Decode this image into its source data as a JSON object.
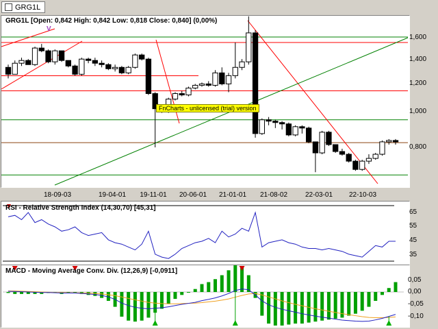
{
  "tab": {
    "label": "GRG1L"
  },
  "price_panel": {
    "title": "GRG1L [Open: 0,842  High: 0,842  Low: 0,818  Close: 0,840] (0,00%)",
    "marker": "V",
    "y_ticks": [
      "1,600",
      "1,400",
      "1,200",
      "1,000",
      "0,800"
    ],
    "x_ticks": [
      "18-09-03",
      "19-04-01",
      "19-11-01",
      "20-06-01",
      "21-01-01",
      "21-08-02",
      "22-03-01",
      "22-10-03"
    ],
    "watermark": "FnCharts - unlicensed (trial) version"
  },
  "rsi_panel": {
    "title": "RSI - Relative Strength Index (14,30,70) [45,31]",
    "y_ticks": [
      "65",
      "55",
      "45",
      "35"
    ]
  },
  "macd_panel": {
    "title": "MACD - Moving Average Conv. Div. (12,26,9) [-0,0911]",
    "y_ticks": [
      "0,05",
      "0,00",
      "-0,05",
      "-0,10"
    ]
  },
  "colors": {
    "up_candle": "#ffffff",
    "down_candle": "#000000",
    "rsi_line": "#2020c0",
    "macd_line": "#2020c0",
    "signal_line": "#f0a020",
    "histogram": "#00a000",
    "green_line": "#008000",
    "red_line": "#ff0000"
  },
  "chart_data": [
    {
      "type": "candlestick",
      "title": "GRG1L [Open: 0,842  High: 0,842  Low: 0,818  Close: 0,840] (0,00%)",
      "y_range": [
        0.58,
        1.77
      ],
      "ohlc": [
        [
          1.38,
          1.4,
          1.3,
          1.33
        ],
        [
          1.33,
          1.43,
          1.33,
          1.41
        ],
        [
          1.41,
          1.45,
          1.39,
          1.43
        ],
        [
          1.43,
          1.44,
          1.4,
          1.4
        ],
        [
          1.4,
          1.53,
          1.39,
          1.52
        ],
        [
          1.52,
          1.55,
          1.49,
          1.5
        ],
        [
          1.5,
          1.51,
          1.41,
          1.42
        ],
        [
          1.42,
          1.51,
          1.4,
          1.5
        ],
        [
          1.5,
          1.5,
          1.42,
          1.43
        ],
        [
          1.43,
          1.43,
          1.38,
          1.39
        ],
        [
          1.39,
          1.4,
          1.32,
          1.33
        ],
        [
          1.33,
          1.45,
          1.32,
          1.44
        ],
        [
          1.44,
          1.45,
          1.41,
          1.43
        ],
        [
          1.43,
          1.45,
          1.39,
          1.41
        ],
        [
          1.41,
          1.43,
          1.38,
          1.4
        ],
        [
          1.4,
          1.41,
          1.36,
          1.37
        ],
        [
          1.37,
          1.4,
          1.35,
          1.38
        ],
        [
          1.38,
          1.39,
          1.33,
          1.34
        ],
        [
          1.34,
          1.39,
          1.33,
          1.38
        ],
        [
          1.38,
          1.48,
          1.37,
          1.47
        ],
        [
          1.47,
          1.48,
          1.43,
          1.44
        ],
        [
          1.44,
          1.45,
          1.18,
          1.19
        ],
        [
          1.19,
          1.2,
          0.8,
          1.08
        ],
        [
          1.08,
          1.1,
          1.05,
          1.06
        ],
        [
          1.06,
          1.16,
          1.05,
          1.15
        ],
        [
          1.15,
          1.2,
          1.14,
          1.19
        ],
        [
          1.19,
          1.21,
          1.17,
          1.18
        ],
        [
          1.18,
          1.24,
          1.17,
          1.23
        ],
        [
          1.23,
          1.26,
          1.22,
          1.25
        ],
        [
          1.25,
          1.27,
          1.24,
          1.26
        ],
        [
          1.26,
          1.28,
          1.24,
          1.25
        ],
        [
          1.25,
          1.36,
          1.24,
          1.34
        ],
        [
          1.34,
          1.38,
          1.25,
          1.26
        ],
        [
          1.26,
          1.34,
          1.2,
          1.32
        ],
        [
          1.32,
          1.56,
          1.3,
          1.38
        ],
        [
          1.38,
          1.44,
          1.36,
          1.42
        ],
        [
          1.42,
          1.75,
          1.4,
          1.63
        ],
        [
          1.63,
          1.65,
          0.87,
          0.9
        ],
        [
          0.9,
          1.01,
          0.89,
          1.0
        ],
        [
          1.0,
          1.02,
          0.96,
          0.99
        ],
        [
          0.99,
          1.0,
          0.94,
          0.98
        ],
        [
          0.98,
          0.99,
          0.93,
          0.97
        ],
        [
          0.97,
          0.98,
          0.88,
          0.89
        ],
        [
          0.89,
          0.96,
          0.88,
          0.95
        ],
        [
          0.95,
          0.96,
          0.9,
          0.94
        ],
        [
          0.94,
          0.95,
          0.83,
          0.84
        ],
        [
          0.84,
          0.84,
          0.62,
          0.76
        ],
        [
          0.76,
          0.92,
          0.75,
          0.91
        ],
        [
          0.91,
          0.92,
          0.81,
          0.82
        ],
        [
          0.82,
          0.82,
          0.76,
          0.77
        ],
        [
          0.77,
          0.79,
          0.74,
          0.75
        ],
        [
          0.75,
          0.76,
          0.69,
          0.7
        ],
        [
          0.7,
          0.71,
          0.63,
          0.64
        ],
        [
          0.64,
          0.71,
          0.63,
          0.7
        ],
        [
          0.7,
          0.75,
          0.68,
          0.72
        ],
        [
          0.72,
          0.76,
          0.71,
          0.75
        ],
        [
          0.75,
          0.85,
          0.74,
          0.84
        ],
        [
          0.84,
          0.86,
          0.82,
          0.85
        ],
        [
          0.85,
          0.86,
          0.82,
          0.84
        ]
      ],
      "horizontal_lines": [
        {
          "value": 1.6,
          "color": "green"
        },
        {
          "value": 1.56,
          "color": "red"
        },
        {
          "value": 1.21,
          "color": "red"
        },
        {
          "value": 1.0,
          "color": "green"
        },
        {
          "value": 0.834,
          "color": "brown"
        },
        {
          "value": 0.6,
          "color": "green"
        }
      ]
    },
    {
      "type": "line",
      "title": "RSI - Relative Strength Index (14,30,70) [45,31]",
      "y_range": [
        30,
        70
      ],
      "values": [
        62,
        63,
        60,
        65,
        58,
        60,
        57,
        55,
        52,
        53,
        55,
        51,
        49,
        50,
        51,
        46,
        44,
        43,
        41,
        39,
        43,
        52,
        36,
        34,
        33,
        36,
        40,
        42,
        44,
        45,
        47,
        44,
        52,
        48,
        50,
        54,
        52,
        65,
        41,
        44,
        45,
        46,
        44,
        43,
        41,
        40,
        40,
        39,
        40,
        39,
        38,
        36,
        35,
        34,
        38,
        42,
        41,
        45,
        45
      ],
      "threshold_lines": [
        70,
        30
      ]
    },
    {
      "type": "line",
      "title": "MACD - Moving Average Conv. Div. (12,26,9) [-0,0911]",
      "y_range": [
        -0.12,
        0.07
      ],
      "series": [
        {
          "values": [
            0.003,
            0.002,
            0.001,
            0.0,
            -0.001,
            -0.002,
            -0.002,
            -0.003,
            -0.004,
            -0.004,
            -0.004,
            -0.006,
            -0.008,
            -0.01,
            -0.014,
            -0.02,
            -0.03,
            -0.045,
            -0.055,
            -0.062,
            -0.066,
            -0.068,
            -0.066,
            -0.064,
            -0.06,
            -0.055,
            -0.05,
            -0.046,
            -0.042,
            -0.035,
            -0.03,
            -0.024,
            -0.016,
            -0.006,
            0.006,
            0.012,
            0.009,
            -0.012,
            -0.036,
            -0.052,
            -0.062,
            -0.07,
            -0.076,
            -0.082,
            -0.088,
            -0.093,
            -0.098,
            -0.102,
            -0.106,
            -0.11,
            -0.114,
            -0.116,
            -0.118,
            -0.119,
            -0.118,
            -0.113,
            -0.107,
            -0.099,
            -0.091
          ]
        },
        {
          "values": [
            0.004,
            0.004,
            0.003,
            0.002,
            0.001,
            0.0,
            -0.001,
            -0.002,
            -0.002,
            -0.003,
            -0.003,
            -0.004,
            -0.005,
            -0.006,
            -0.008,
            -0.011,
            -0.015,
            -0.02,
            -0.026,
            -0.032,
            -0.037,
            -0.042,
            -0.045,
            -0.047,
            -0.048,
            -0.048,
            -0.047,
            -0.046,
            -0.045,
            -0.043,
            -0.04,
            -0.037,
            -0.033,
            -0.028,
            -0.021,
            -0.014,
            -0.008,
            -0.006,
            -0.012,
            -0.02,
            -0.028,
            -0.036,
            -0.043,
            -0.05,
            -0.056,
            -0.062,
            -0.068,
            -0.073,
            -0.078,
            -0.083,
            -0.088,
            -0.092,
            -0.096,
            -0.1,
            -0.103,
            -0.104,
            -0.104,
            -0.103,
            -0.101
          ]
        }
      ]
    }
  ]
}
